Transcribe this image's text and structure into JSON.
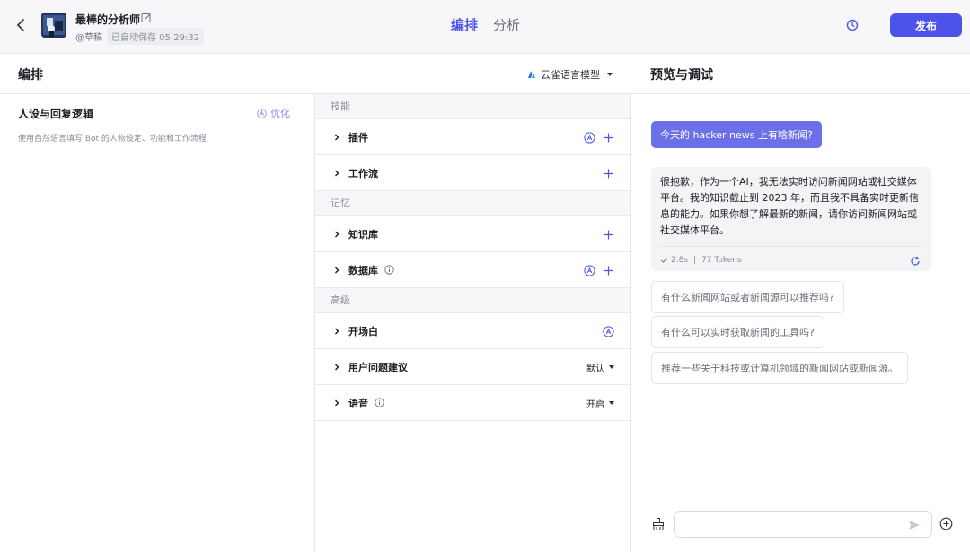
{
  "header": {
    "bot_name": "最棒的分析师",
    "status": "@草稿",
    "autosave": "已自动保存 05:29:32",
    "tabs": [
      {
        "label": "编排",
        "active": true
      },
      {
        "label": "分析",
        "active": false
      }
    ],
    "publish_label": "发布"
  },
  "editor": {
    "title": "编排",
    "model_label": "云雀语言模型"
  },
  "persona": {
    "title": "人设与回复逻辑",
    "optimize_label": "优化",
    "placeholder": "使用自然语言填写 Bot 的人物设定、功能和工作流程"
  },
  "skills": {
    "groups": [
      {
        "label": "技能"
      },
      {
        "label": "记忆"
      },
      {
        "label": "高级"
      }
    ],
    "rows": {
      "plugins": "插件",
      "workflow": "工作流",
      "knowledge": "知识库",
      "database": "数据库",
      "opening": "开场白",
      "suggestions": "用户问题建议",
      "voice": "语音"
    },
    "suggestions_value": "默认",
    "voice_value": "开启"
  },
  "preview": {
    "title": "预览与调试",
    "user_message": "今天的 hacker news 上有啥新闻?",
    "bot_message": "很抱歉，作为一个AI，我无法实时访问新闻网站或社交媒体平台。我的知识截止到 2023 年，而且我不具备实时更新信息的能力。如果你想了解最新的新闻，请你访问新闻网站或社交媒体平台。",
    "bot_time": "2.8s",
    "bot_tokens": "77 Tokens",
    "suggestions": [
      "有什么新闻网站或者新闻源可以推荐吗?",
      "有什么可以实时获取新闻的工具吗?",
      "推荐一些关于科技或计算机领域的新闻网站或新闻源。"
    ],
    "input_placeholder": ""
  },
  "colors": {
    "accent": "#4d53e8",
    "user_bubble": "#6c70e8"
  }
}
